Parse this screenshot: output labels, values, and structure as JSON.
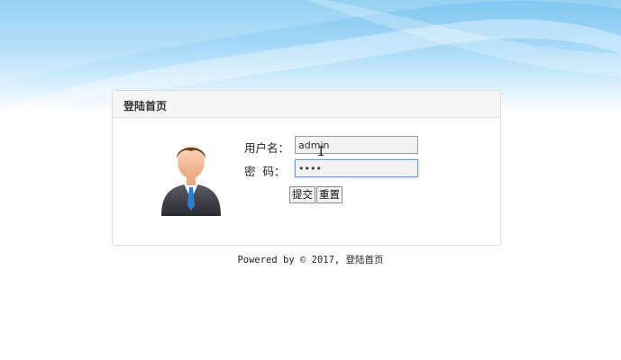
{
  "panel": {
    "title": "登陆首页"
  },
  "form": {
    "username_label": "用户名：",
    "username_value": "admin",
    "password_label": "密  码：",
    "password_value": "••••",
    "submit_label": "提交",
    "reset_label": "重置"
  },
  "footer": {
    "text": "Powered by © 2017, 登陆首页"
  },
  "colors": {
    "sky": "#9fd6f6",
    "panel_header_bg": "#f5f5f5",
    "focus_border": "#6aa0d8"
  },
  "icons": {
    "avatar": "user-avatar-icon",
    "cursor": "text-cursor-icon"
  }
}
